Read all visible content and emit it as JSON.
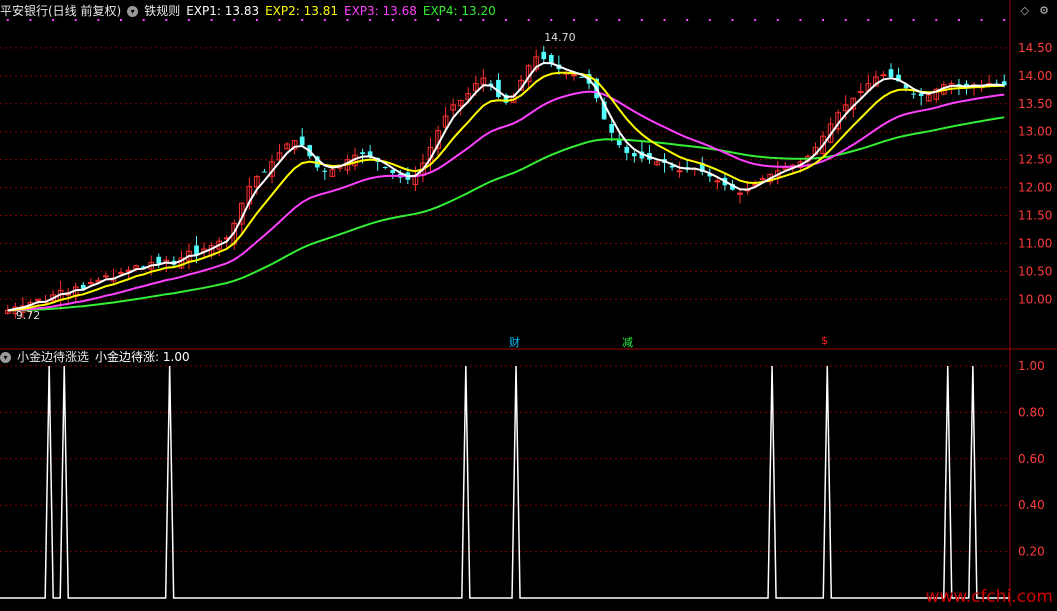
{
  "header": {
    "stock_name": "平安银行(日线 前复权)",
    "indicator_name": "铁规则",
    "exp": [
      {
        "label": "EXP1: 13.83",
        "color": "#ffffff"
      },
      {
        "label": "EXP2: 13.81",
        "color": "#ffff00"
      },
      {
        "label": "EXP3: 13.68",
        "color": "#ff40ff"
      },
      {
        "label": "EXP4: 13.20",
        "color": "#33ee33"
      }
    ]
  },
  "sub_header": {
    "indicator_name": "小金边待涨选",
    "value_label": "小金边待涨: 1.00"
  },
  "top_icons": {
    "diamond": "◇",
    "gear": "⚙"
  },
  "annotations": {
    "high": "14.70",
    "low": "9.72"
  },
  "markers": [
    {
      "text": "财",
      "color": "#00bfff"
    },
    {
      "text": "减",
      "color": "#22ee44"
    },
    {
      "text": "$",
      "color": "#ff2020"
    }
  ],
  "watermark": "www.cfchi.com",
  "colors": {
    "up": "#ff3030",
    "down": "#54ffff",
    "exp1": "#ffffff",
    "exp2": "#ffff00",
    "exp3": "#ff40ff",
    "exp4": "#33ee33",
    "grid": "#800000",
    "axis_text": "#ff3c3c",
    "signal": "#ffffff"
  },
  "chart_data": [
    {
      "type": "candlestick",
      "title": "平安银行(日线 前复权)",
      "y_ticks": [
        14.5,
        14.0,
        13.5,
        13.0,
        12.5,
        12.0,
        11.5,
        11.0,
        10.5,
        10.0
      ],
      "ylim": [
        9.45,
        15.0
      ],
      "annotations": [
        {
          "label": "14.70",
          "type": "high"
        },
        {
          "label": "9.72",
          "type": "low"
        }
      ],
      "series_last_values": {
        "EXP1": 13.83,
        "EXP2": 13.81,
        "EXP3": 13.68,
        "EXP4": 13.2
      },
      "close": [
        9.8,
        9.86,
        9.88,
        9.94,
        10.0,
        9.96,
        10.08,
        10.16,
        10.12,
        10.22,
        10.18,
        10.3,
        10.34,
        10.42,
        10.38,
        10.48,
        10.52,
        10.6,
        10.56,
        10.66,
        10.64,
        10.7,
        10.62,
        10.74,
        10.86,
        10.8,
        10.9,
        10.96,
        11.04,
        11.1,
        11.36,
        11.72,
        12.02,
        12.2,
        12.28,
        12.46,
        12.62,
        12.78,
        12.84,
        12.76,
        12.56,
        12.36,
        12.28,
        12.32,
        12.4,
        12.5,
        12.58,
        12.6,
        12.56,
        12.46,
        12.36,
        12.26,
        12.18,
        12.14,
        12.22,
        12.44,
        12.72,
        13.02,
        13.28,
        13.48,
        13.56,
        13.68,
        13.86,
        13.96,
        13.82,
        13.62,
        13.52,
        13.64,
        13.92,
        14.18,
        14.34,
        14.3,
        14.22,
        14.12,
        14.06,
        14.02,
        13.98,
        13.86,
        13.6,
        13.22,
        12.98,
        12.76,
        12.62,
        12.56,
        12.52,
        12.5,
        12.46,
        12.44,
        12.36,
        12.3,
        12.32,
        12.34,
        12.28,
        12.2,
        12.12,
        12.04,
        11.96,
        11.9,
        11.96,
        12.06,
        12.16,
        12.24,
        12.3,
        12.36,
        12.4,
        12.46,
        12.56,
        12.72,
        12.92,
        13.14,
        13.34,
        13.48,
        13.6,
        13.72,
        13.86,
        13.98,
        14.02,
        13.98,
        13.9,
        13.78,
        13.68,
        13.64,
        13.66,
        13.76,
        13.84,
        13.86,
        13.82,
        13.8,
        13.84,
        13.82,
        13.86,
        13.84,
        13.83
      ],
      "ema_periods": {
        "EXP1": 3,
        "EXP2": 8,
        "EXP3": 21,
        "EXP4": 55
      }
    },
    {
      "type": "line",
      "title": "小金边待涨选",
      "series": [
        {
          "name": "小金边待涨",
          "last": 1.0
        }
      ],
      "y_ticks": [
        1.0,
        0.8,
        0.6,
        0.4,
        0.2
      ],
      "ylim": [
        0,
        1
      ],
      "signal_index": [
        9,
        12,
        33,
        92,
        102,
        153,
        164,
        188,
        193
      ]
    }
  ]
}
